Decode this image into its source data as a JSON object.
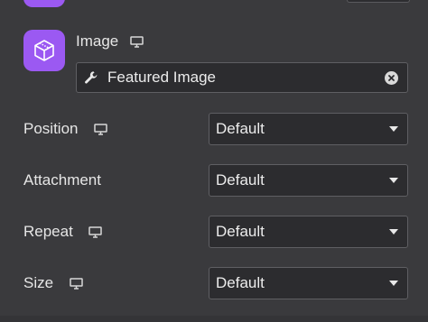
{
  "image_control": {
    "label": "Image",
    "dynamic_value": "Featured Image"
  },
  "rows": [
    {
      "label": "Position",
      "value": "Default",
      "responsive": true
    },
    {
      "label": "Attachment",
      "value": "Default",
      "responsive": false
    },
    {
      "label": "Repeat",
      "value": "Default",
      "responsive": true
    },
    {
      "label": "Size",
      "value": "Default",
      "responsive": true
    }
  ],
  "colors": {
    "accent": "#9b59f2",
    "panel_bg": "#3a3a3d",
    "field_bg": "#2c2c2f"
  },
  "icons": {
    "image_tile": "cube-icon",
    "responsive": "monitor-icon",
    "dynamic": "wrench-icon",
    "clear": "clear-icon",
    "dropdown": "caret-down-icon"
  }
}
